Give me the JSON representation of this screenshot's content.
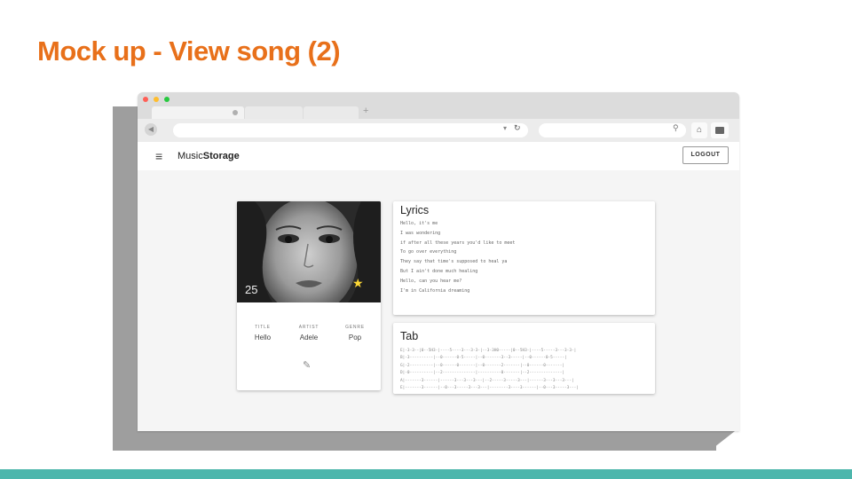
{
  "slide": {
    "title": "Mock up - View song (2)",
    "accent": "#e8701a",
    "band": "#4db6ac"
  },
  "browser": {
    "url": "",
    "search": "",
    "icons": [
      "back-icon",
      "reload-icon",
      "search-icon",
      "home-icon",
      "menu-icon"
    ]
  },
  "app": {
    "brand_light": "Music",
    "brand_bold": "Storage",
    "logout": "LOGOUT"
  },
  "song": {
    "cover_number": "25",
    "title_label": "TITLE",
    "title": "Hello",
    "artist_label": "ARTIST",
    "artist": "Adele",
    "genre_label": "GENRE",
    "genre": "Pop",
    "favorite": true
  },
  "lyrics": {
    "heading": "Lyrics",
    "lines": [
      "Hello, it's me",
      "I was wondering",
      "if after all these years you'd like to meet",
      "To go over everything",
      "They say that time's supposed to heal ya",
      "But I ain't done much healing",
      "Hello, can you hear me?",
      "I'm in California dreaming"
    ]
  },
  "tab": {
    "heading": "Tab",
    "lines": [
      "E|-3-3--|0--5H3-|----5----3---3-3-|--3-3H0-----|0--5H3-|----5-----3---3-3-|",
      "B|-3----------|--0------0-5-----|--0-------3--3-----|--0------0-5-----|",
      "G|-2----------|--0------0-------|--0-------2-------|--0------0-------|",
      "D|-0----------|--2--------------|----------0-------|--2--------------|",
      "A|-------3------|------3---3---3---|--2-----3-----3---|------3---3---3---|",
      "E|-------3------|--0---3-----3---3---|--------3----3------|--0---3-----3---|"
    ]
  }
}
